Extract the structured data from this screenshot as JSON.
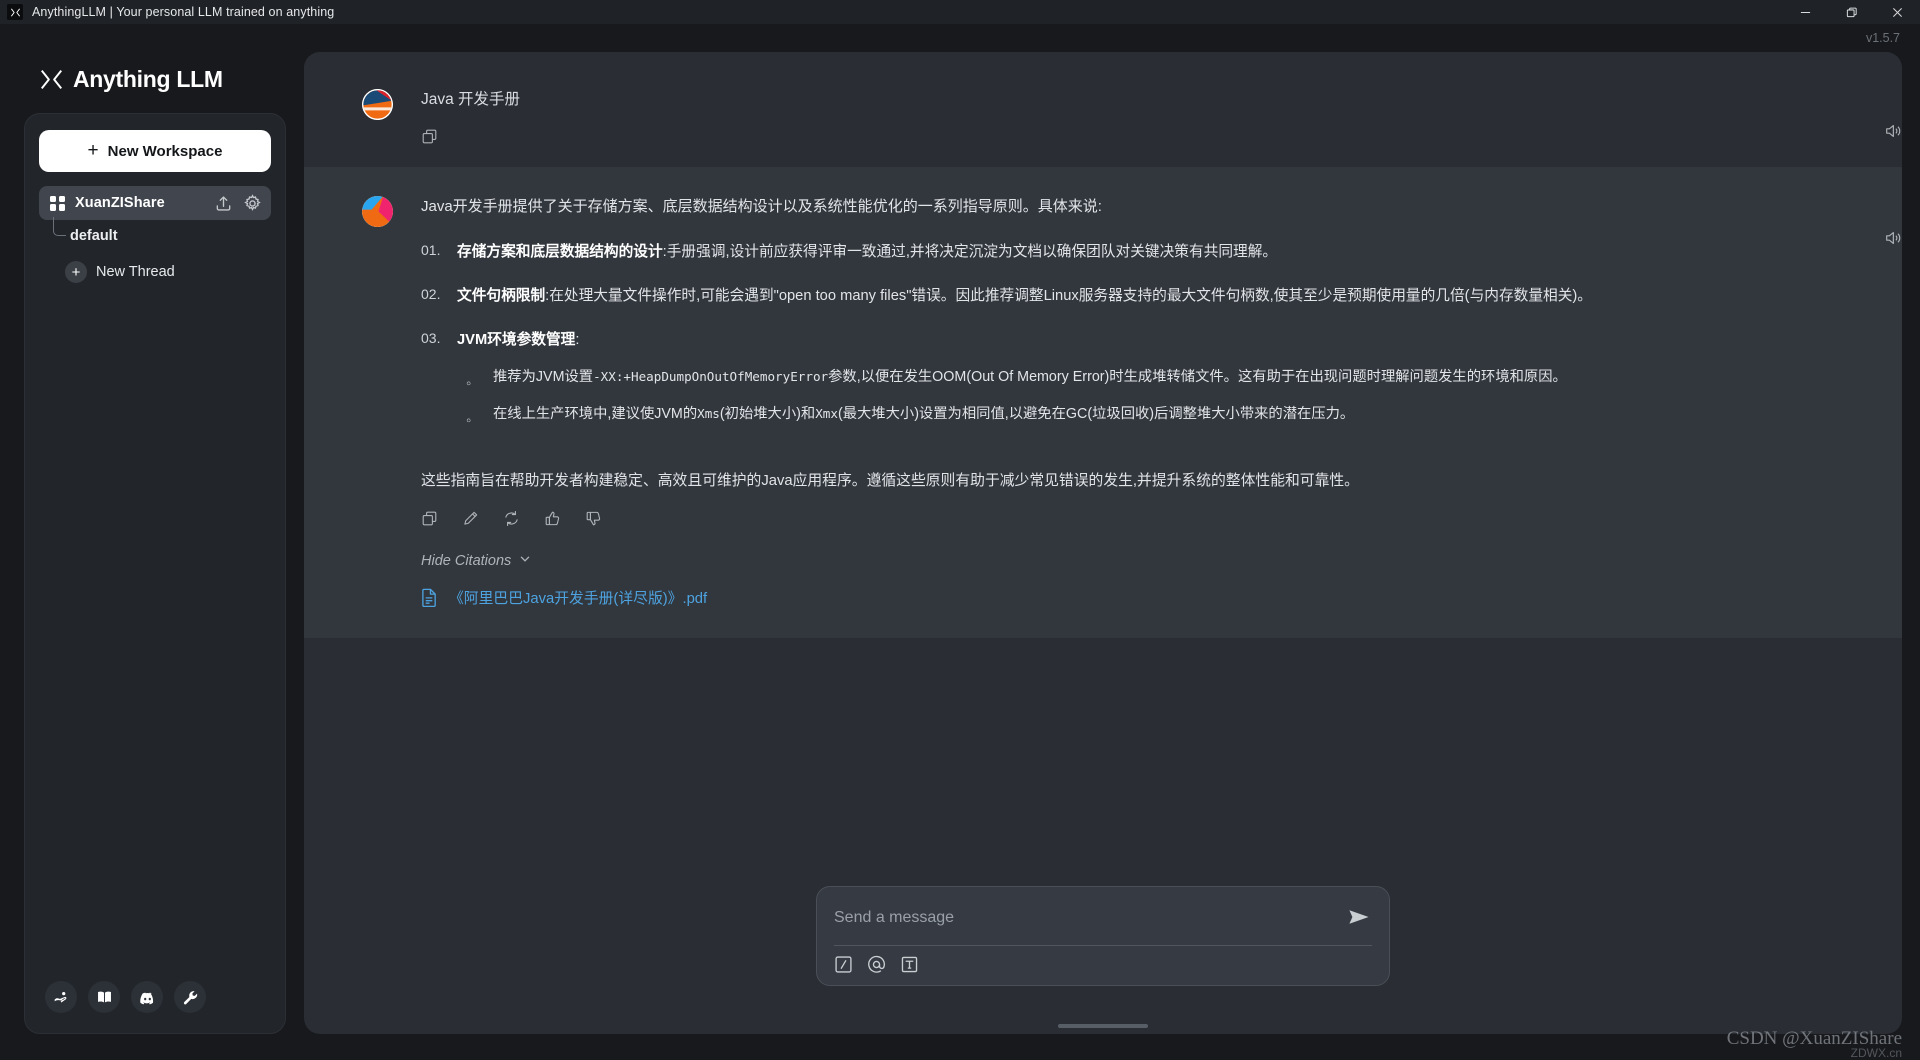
{
  "window": {
    "title": "AnythingLLM | Your personal LLM trained on anything",
    "app_icon": "anythingllm-logo-icon",
    "minimize_label": "Minimize",
    "maximize_label": "Restore",
    "close_label": "Close",
    "version": "v1.5.7"
  },
  "sidebar": {
    "brand": "Anything LLM",
    "new_workspace_label": "New Workspace",
    "new_workspace_plus": "+",
    "workspaces": [
      {
        "name": "XuanZIShare",
        "upload_icon": "upload-icon",
        "settings_icon": "gear-icon",
        "threads": [
          {
            "name": "default"
          }
        ],
        "new_thread_label": "New Thread",
        "new_thread_plus": "+"
      }
    ],
    "footer_buttons": [
      {
        "name": "support-icon",
        "title": "Support"
      },
      {
        "name": "book-icon",
        "title": "Documentation"
      },
      {
        "name": "discord-icon",
        "title": "Discord"
      },
      {
        "name": "wrench-icon",
        "title": "Settings"
      }
    ]
  },
  "chat": {
    "user_message": {
      "avatar": "user-avatar",
      "text": "Java 开发手册",
      "actions": [
        {
          "name": "copy-icon"
        }
      ],
      "speaker_icon": "speaker-icon"
    },
    "assistant_message": {
      "avatar": "assistant-avatar",
      "intro": "Java开发手册提供了关于存储方案、底层数据结构设计以及系统性能优化的一系列指导原则。具体来说:",
      "items": [
        {
          "num": "01.",
          "title": "存储方案和底层数据结构的设计",
          "sep": ":",
          "body": "手册强调,设计前应获得评审一致通过,并将决定沉淀为文档以确保团队对关键决策有共同理解。"
        },
        {
          "num": "02.",
          "title": "文件句柄限制",
          "sep": ":",
          "body": "在处理大量文件操作时,可能会遇到\"open too many files\"错误。因此推荐调整Linux服务器支持的最大文件句柄数,使其至少是预期使用量的几倍(与内存数量相关)。"
        },
        {
          "num": "03.",
          "title": "JVM环境参数管理",
          "sep": ":",
          "body": "",
          "subitems": [
            {
              "pre": "推荐为JVM设置",
              "code": "-XX:+HeapDumpOnOutOfMemoryError",
              "post": "参数,以便在发生OOM(Out Of Memory Error)时生成堆转储文件。这有助于在出现问题时理解问题发生的环境和原因。"
            },
            {
              "pre": "在线上生产环境中,建议使JVM的",
              "code": "Xms",
              "mid": "(初始堆大小)和",
              "code2": "Xmx",
              "post": "(最大堆大小)设置为相同值,以避免在GC(垃圾回收)后调整堆大小带来的潜在压力。"
            }
          ]
        }
      ],
      "closing": "这些指南旨在帮助开发者构建稳定、高效且可维护的Java应用程序。遵循这些原则有助于减少常见错误的发生,并提升系统的整体性能和可靠性。",
      "actions": [
        {
          "name": "copy-icon"
        },
        {
          "name": "edit-icon"
        },
        {
          "name": "regenerate-icon"
        },
        {
          "name": "thumbs-up-icon"
        },
        {
          "name": "thumbs-down-icon"
        }
      ],
      "speaker_icon": "speaker-icon",
      "citations_toggle": "Hide Citations",
      "citations": [
        {
          "file_icon": "file-text-icon",
          "name": "《阿里巴巴Java开发手册(详尽版)》.pdf"
        }
      ]
    }
  },
  "composer": {
    "placeholder": "Send a message",
    "value": "",
    "send_icon": "send-icon",
    "tools": [
      {
        "name": "slash-command-icon",
        "glyph": "/"
      },
      {
        "name": "mention-icon",
        "glyph": "@"
      },
      {
        "name": "text-style-icon",
        "glyph": "T"
      }
    ]
  },
  "watermark": {
    "primary": "CSDN @XuanZIShare",
    "secondary": "ZDWX.cn"
  },
  "colors": {
    "accent_link": "#4da3e0",
    "sidebar_bg": "#22262b",
    "main_bg": "#2a2e34",
    "assistant_bg": "#32373e"
  }
}
